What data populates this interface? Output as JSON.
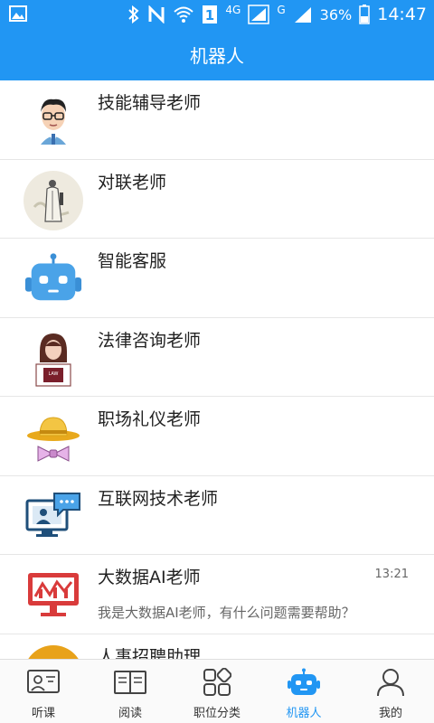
{
  "status_bar": {
    "battery": "36%",
    "time": "14:47",
    "network_4g": "4G",
    "network_g": "G"
  },
  "header": {
    "title": "机器人"
  },
  "items": [
    {
      "name": "技能辅导老师",
      "time": "",
      "preview": "",
      "icon": "teacher-glasses-avatar"
    },
    {
      "name": "对联老师",
      "time": "",
      "preview": "",
      "icon": "scholar-painting-avatar"
    },
    {
      "name": "智能客服",
      "time": "",
      "preview": "",
      "icon": "robot-avatar"
    },
    {
      "name": "法律咨询老师",
      "time": "",
      "preview": "",
      "icon": "lawyer-avatar"
    },
    {
      "name": "职场礼仪老师",
      "time": "",
      "preview": "",
      "icon": "hat-bowtie-avatar"
    },
    {
      "name": "互联网技术老师",
      "time": "",
      "preview": "",
      "icon": "computer-chat-avatar"
    },
    {
      "name": "大数据AI老师",
      "time": "13:21",
      "preview": "我是大数据AI老师，有什么问题需要帮助？",
      "icon": "chart-monitor-avatar"
    },
    {
      "name": "人事招聘助理",
      "time": "",
      "preview": "",
      "icon": "hr-avatar"
    }
  ],
  "bottom_nav": {
    "items": [
      {
        "label": "听课",
        "icon": "lecture-icon"
      },
      {
        "label": "阅读",
        "icon": "book-icon"
      },
      {
        "label": "职位分类",
        "icon": "category-icon"
      },
      {
        "label": "机器人",
        "icon": "robot-icon",
        "active": true
      },
      {
        "label": "我的",
        "icon": "user-icon"
      }
    ]
  },
  "colors": {
    "primary": "#2196f3",
    "active_tab": "#2196f3",
    "text": "#222222",
    "secondary_text": "#666666",
    "divider": "#e6e6e6"
  }
}
